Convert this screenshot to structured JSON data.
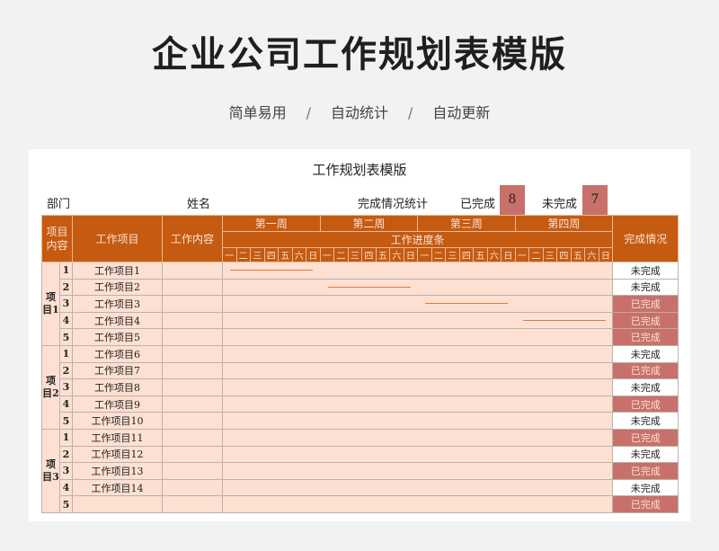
{
  "header": {
    "title": "企业公司工作规划表模版",
    "features": [
      "简单易用",
      "自动统计",
      "自动更新"
    ],
    "separator": "/"
  },
  "sheet": {
    "title": "工作规划表模版",
    "dept_label": "部门",
    "name_label": "姓名",
    "stats_label": "完成情况统计",
    "done_label": "已完成",
    "done_count": "8",
    "todo_label": "未完成",
    "todo_count": "7"
  },
  "columns": {
    "group": "项目内容",
    "item": "工作项目",
    "content": "工作内容",
    "weeks": [
      "第一周",
      "第二周",
      "第三周",
      "第四周"
    ],
    "progress": "工作进度条",
    "days": [
      "一",
      "二",
      "三",
      "四",
      "五",
      "六",
      "日"
    ],
    "status": "完成情况"
  },
  "groups": [
    {
      "label": "项目1",
      "rows": [
        {
          "no": "1",
          "item": "工作项目1",
          "status": "未完成",
          "done": false,
          "bar_week": 1
        },
        {
          "no": "2",
          "item": "工作项目2",
          "status": "未完成",
          "done": false,
          "bar_week": 2
        },
        {
          "no": "3",
          "item": "工作项目3",
          "status": "已完成",
          "done": true,
          "bar_week": 3
        },
        {
          "no": "4",
          "item": "工作项目4",
          "status": "已完成",
          "done": true,
          "bar_week": 4
        },
        {
          "no": "5",
          "item": "工作项目5",
          "status": "已完成",
          "done": true,
          "bar_week": 0
        }
      ]
    },
    {
      "label": "项目2",
      "rows": [
        {
          "no": "1",
          "item": "工作项目6",
          "status": "未完成",
          "done": false,
          "bar_week": 0
        },
        {
          "no": "2",
          "item": "工作项目7",
          "status": "已完成",
          "done": true,
          "bar_week": 0
        },
        {
          "no": "3",
          "item": "工作项目8",
          "status": "未完成",
          "done": false,
          "bar_week": 0
        },
        {
          "no": "4",
          "item": "工作项目9",
          "status": "已完成",
          "done": true,
          "bar_week": 0
        },
        {
          "no": "5",
          "item": "工作项目10",
          "status": "未完成",
          "done": false,
          "bar_week": 0
        }
      ]
    },
    {
      "label": "项目3",
      "rows": [
        {
          "no": "1",
          "item": "工作项目11",
          "status": "已完成",
          "done": true,
          "bar_week": 0
        },
        {
          "no": "2",
          "item": "工作项目12",
          "status": "未完成",
          "done": false,
          "bar_week": 0
        },
        {
          "no": "3",
          "item": "工作项目13",
          "status": "已完成",
          "done": true,
          "bar_week": 0
        },
        {
          "no": "4",
          "item": "工作项目14",
          "status": "未完成",
          "done": false,
          "bar_week": 0
        },
        {
          "no": "5",
          "item": "",
          "status": "已完成",
          "done": true,
          "bar_week": 0
        }
      ]
    }
  ],
  "colors": {
    "header_bg": "#c55a11",
    "row_bg": "#fde0d2",
    "done_bg": "#c8706a",
    "bar": "#e07b39"
  }
}
